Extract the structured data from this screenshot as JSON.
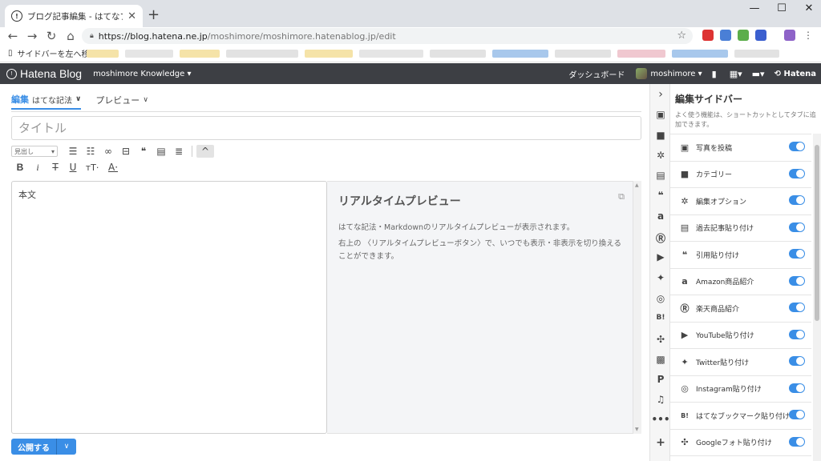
{
  "browser": {
    "tab_title": "ブログ記事編集 - はてなブログ",
    "url_host": "https://blog.hatena.ne.jp",
    "url_path": "/moshimore/moshimore.hatenablog.jp/edit",
    "bookmark_label": "サイドバーを左へ移動"
  },
  "header": {
    "logo": "Hatena Blog",
    "blog_name": "moshimore Knowledge",
    "dashboard": "ダッシュボード",
    "user": "moshimore",
    "hatena": "Hatena"
  },
  "editor": {
    "tab_edit": "編集",
    "tab_edit_sub": "はてな記法",
    "tab_preview": "プレビュー",
    "title_placeholder": "タイトル",
    "heading_select": "見出し",
    "body_placeholder": "本文",
    "publish": "公開する"
  },
  "preview": {
    "title": "リアルタイムプレビュー",
    "line1": "はてな記法・Markdownのリアルタイムプレビューが表示されます。",
    "line2": "右上の 〈リアルタイムプレビューボタン〉で、いつでも表示・非表示を切り換えることができます。"
  },
  "sidebar": {
    "title": "編集サイドバー",
    "desc": "よく使う機能は、ショートカットとしてタブに追加できます。",
    "items": [
      {
        "label": "写真を投稿",
        "icon": "photo-icon"
      },
      {
        "label": "カテゴリー",
        "icon": "folder-icon"
      },
      {
        "label": "編集オプション",
        "icon": "gear-icon"
      },
      {
        "label": "過去記事貼り付け",
        "icon": "document-icon"
      },
      {
        "label": "引用貼り付け",
        "icon": "quote-icon"
      },
      {
        "label": "Amazon商品紹介",
        "icon": "amazon-icon"
      },
      {
        "label": "楽天商品紹介",
        "icon": "rakuten-icon"
      },
      {
        "label": "YouTube貼り付け",
        "icon": "youtube-icon"
      },
      {
        "label": "Twitter貼り付け",
        "icon": "twitter-icon"
      },
      {
        "label": "Instagram貼り付け",
        "icon": "instagram-icon"
      },
      {
        "label": "はてなブックマーク貼り付け",
        "icon": "hatena-bookmark-icon"
      },
      {
        "label": "Googleフォト貼り付け",
        "icon": "google-photos-icon"
      }
    ]
  },
  "colors": {
    "accent": "#3a8ee6",
    "header_bg": "#3d3f44"
  }
}
